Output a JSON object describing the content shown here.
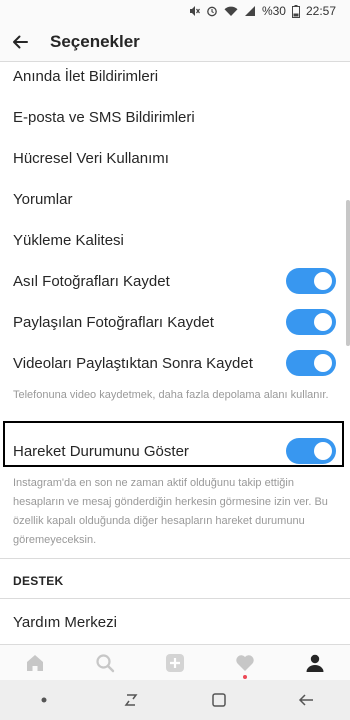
{
  "status_bar": {
    "battery": "%30",
    "time": "22:57"
  },
  "header": {
    "title": "Seçenekler"
  },
  "settings": {
    "items": [
      {
        "label": "Anında İlet Bildirimleri"
      },
      {
        "label": "E-posta ve SMS Bildirimleri"
      },
      {
        "label": "Hücresel Veri Kullanımı"
      },
      {
        "label": "Yorumlar"
      },
      {
        "label": "Yükleme Kalitesi"
      }
    ],
    "toggles": [
      {
        "label": "Asıl Fotoğrafları Kaydet",
        "on": true
      },
      {
        "label": "Paylaşılan Fotoğrafları Kaydet",
        "on": true
      },
      {
        "label": "Videoları Paylaştıktan Sonra Kaydet",
        "on": true
      }
    ],
    "video_note": "Telefonuna video kaydetmek, daha fazla depolama alanı kullanır.",
    "activity_status": {
      "label": "Hareket Durumunu Göster",
      "on": true
    },
    "activity_note": "Instagram'da en son ne zaman aktif olduğunu takip ettiğin hesapların ve mesaj gönderdiğin herkesin görmesine izin ver. Bu özellik kapalı olduğunda diğer hesapların hareket durumunu göremeyeceksin.",
    "support_header": "DESTEK",
    "help_center": "Yardım Merkezi"
  },
  "tab_bar": {
    "tabs": [
      {
        "icon": "home-icon"
      },
      {
        "icon": "search-icon"
      },
      {
        "icon": "add-icon"
      },
      {
        "icon": "heart-icon"
      },
      {
        "icon": "profile-icon"
      }
    ]
  },
  "colors": {
    "accent": "#3897f0",
    "text": "#262626",
    "muted": "#999999",
    "divider": "#dbdbdb",
    "notification": "#ed4956"
  }
}
